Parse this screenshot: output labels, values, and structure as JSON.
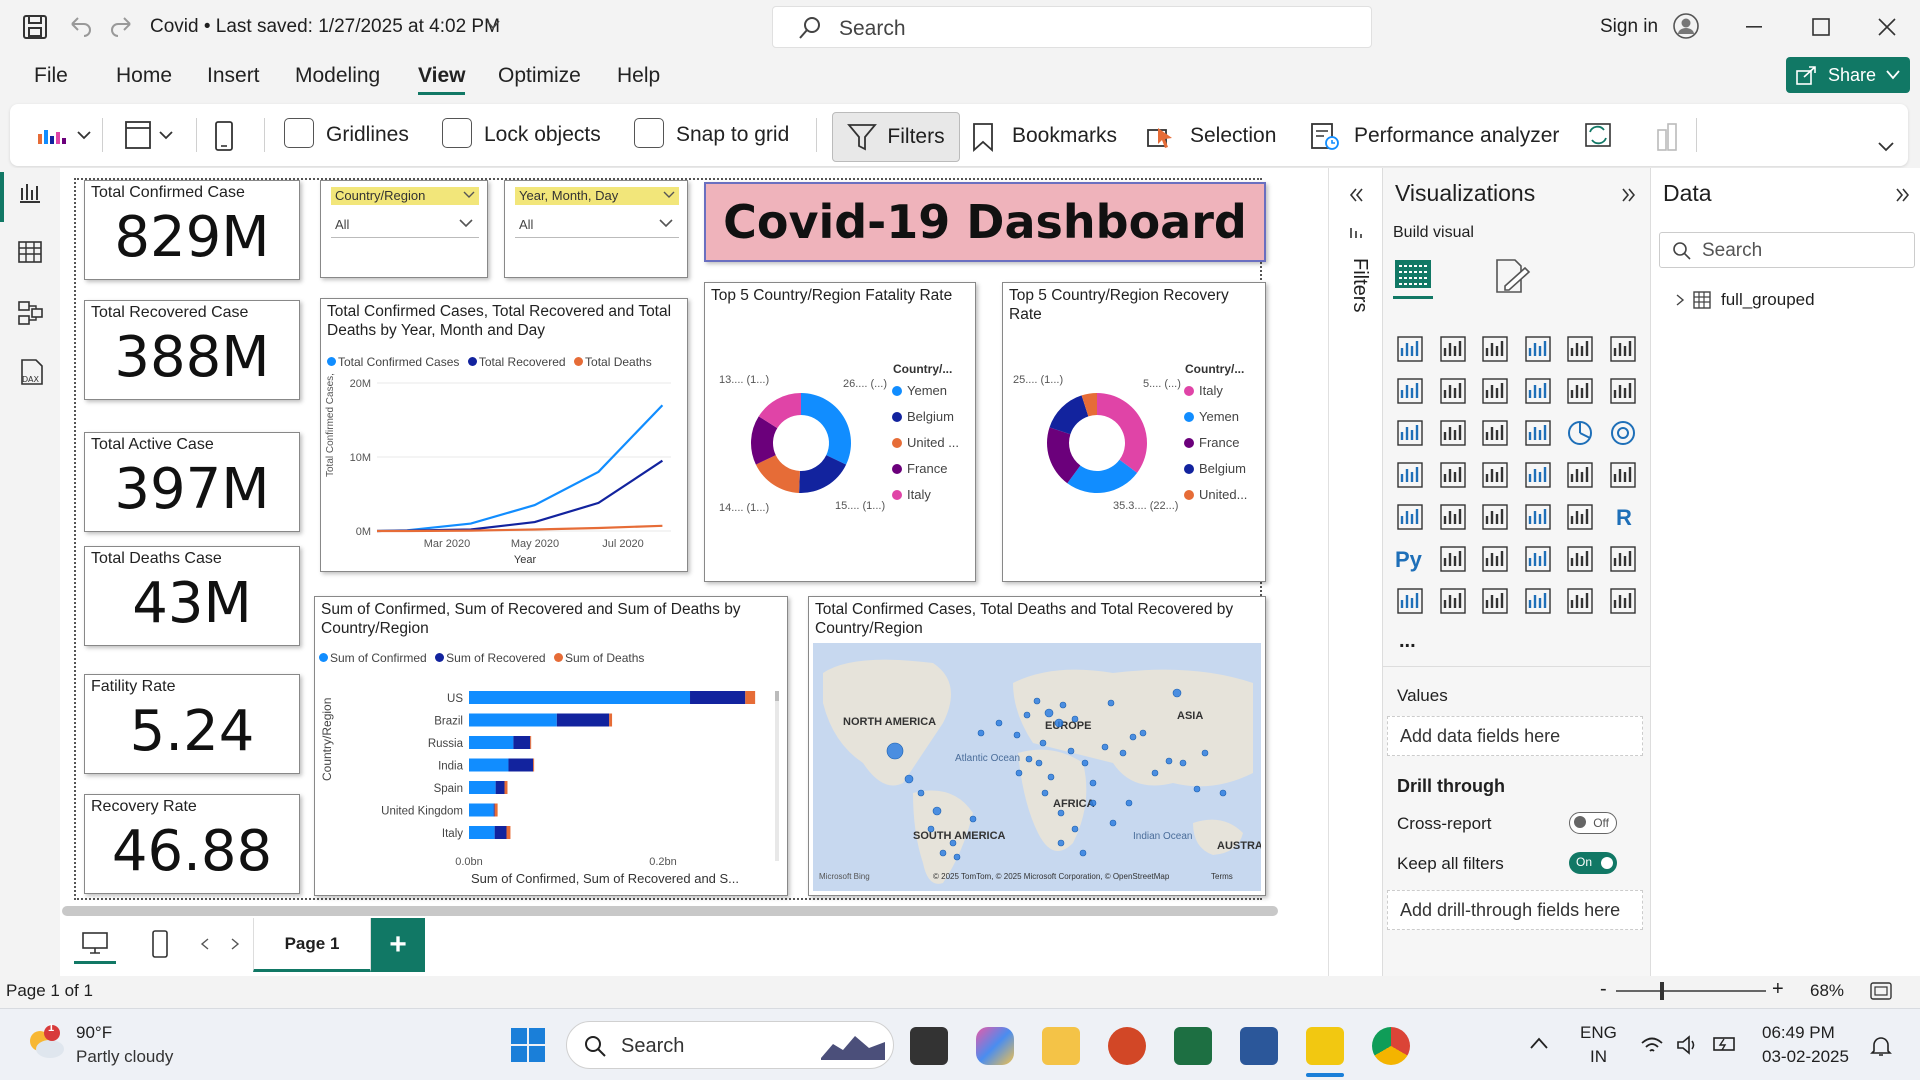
{
  "titlebar": {
    "doc_title": "Covid • Last saved: 1/27/2025 at 4:02 PM",
    "search_placeholder": "Search",
    "sign_in": "Sign in"
  },
  "menu": {
    "items": [
      "File",
      "Home",
      "Insert",
      "Modeling",
      "View",
      "Optimize",
      "Help"
    ],
    "active": "View",
    "share": "Share"
  },
  "ribbon": {
    "gridlines": "Gridlines",
    "lock_objects": "Lock objects",
    "snap_to_grid": "Snap to grid",
    "filters": "Filters",
    "bookmarks": "Bookmarks",
    "selection": "Selection",
    "performance_analyzer": "Performance analyzer"
  },
  "kpis": [
    {
      "label": "Total Confirmed Case",
      "value": "829M"
    },
    {
      "label": "Total Recovered Case",
      "value": "388M"
    },
    {
      "label": "Total Active Case",
      "value": "397M"
    },
    {
      "label": "Total Deaths Case",
      "value": "43M"
    },
    {
      "label": "Fatility Rate",
      "value": "5.24"
    },
    {
      "label": "Recovery Rate",
      "value": "46.88"
    }
  ],
  "slicers": [
    {
      "field": "Country/Region",
      "value": "All"
    },
    {
      "field": "Year, Month, Day",
      "value": "All"
    }
  ],
  "dashboard_title": "Covid-19 Dashboard",
  "line_chart": {
    "title": "Total Confirmed Cases, Total Recovered and Total Deaths by Year, Month and Day",
    "legend": [
      "Total Confirmed Cases",
      "Total Recovered",
      "Total Deaths"
    ],
    "colors": [
      "#118DFF",
      "#12239E",
      "#E66C37"
    ],
    "y_ticks": [
      "20M",
      "10M",
      "0M"
    ],
    "x_ticks": [
      "Mar 2020",
      "May 2020",
      "Jul 2020"
    ],
    "ylabel": "Total Confirmed Cases, Total ...",
    "xlabel": "Year"
  },
  "donut_fatality": {
    "title": "Top 5 Country/Region Fatality Rate",
    "legend_title": "Country/...",
    "legend": [
      "Yemen",
      "Belgium",
      "United ...",
      "France",
      "Italy"
    ],
    "colors": [
      "#118DFF",
      "#12239E",
      "#E66C37",
      "#6B007B",
      "#E044A7"
    ],
    "labels": [
      "13.... (1...)",
      "26.... (...)",
      "14.... (1...)",
      "15.... (1...)"
    ]
  },
  "donut_recovery": {
    "title": "Top 5 Country/Region Recovery Rate",
    "legend_title": "Country/...",
    "legend": [
      "Italy",
      "Yemen",
      "France",
      "Belgium",
      "United..."
    ],
    "colors": [
      "#E044A7",
      "#118DFF",
      "#6B007B",
      "#12239E",
      "#E66C37"
    ],
    "labels": [
      "25.... (1...)",
      "5.... (...)",
      "35.3.... (22...)"
    ]
  },
  "bar_chart": {
    "title": "Sum of Confirmed, Sum of Recovered and Sum of Deaths by Country/Region",
    "legend": [
      "Sum of Confirmed",
      "Sum of Recovered",
      "Sum of Deaths"
    ],
    "ylabel": "Country/Region",
    "xlabel": "Sum of Confirmed, Sum of Recovered and S...",
    "x_ticks": [
      "0.0bn",
      "0.2bn"
    ]
  },
  "map": {
    "title": "Total Confirmed Cases, Total Deaths and Total Recovered by Country/Region",
    "labels": [
      "NORTH AMERICA",
      "EUROPE",
      "ASIA",
      "Atlantic Ocean",
      "AFRICA",
      "SOUTH AMERICA",
      "Indian Ocean",
      "AUSTRAL"
    ],
    "brand": "Microsoft Bing",
    "credit": "© 2025 TomTom, © 2025 Microsoft Corporation, © OpenStreetMap",
    "terms": "Terms"
  },
  "chart_data": [
    {
      "type": "line",
      "x": [
        "Mar 2020",
        "Apr 2020",
        "May 2020",
        "Jun 2020",
        "Jul 2020"
      ],
      "series": [
        {
          "name": "Total Confirmed Cases",
          "values": [
            0.1,
            1.0,
            3.5,
            8.0,
            17.0
          ]
        },
        {
          "name": "Total Recovered",
          "values": [
            0.05,
            0.2,
            1.2,
            3.8,
            9.5
          ]
        },
        {
          "name": "Total Deaths",
          "values": [
            0,
            0.05,
            0.2,
            0.4,
            0.7
          ]
        }
      ],
      "ylim": [
        0,
        20
      ]
    },
    {
      "type": "pie",
      "categories": [
        "Yemen",
        "Belgium",
        "United ...",
        "France",
        "Italy"
      ],
      "values": [
        26,
        15,
        14,
        13,
        13
      ]
    },
    {
      "type": "pie",
      "categories": [
        "Italy",
        "Yemen",
        "France",
        "Belgium",
        "United..."
      ],
      "values": [
        35.3,
        25,
        20,
        15,
        5
      ]
    },
    {
      "type": "bar",
      "categories": [
        "US",
        "Brazil",
        "Russia",
        "India",
        "Spain",
        "United Kingdom",
        "Italy"
      ],
      "series": [
        {
          "name": "Sum of Confirmed",
          "values": [
            0.224,
            0.089,
            0.045,
            0.04,
            0.027,
            0.025,
            0.026
          ]
        },
        {
          "name": "Sum of Recovered",
          "values": [
            0.056,
            0.053,
            0.017,
            0.025,
            0.009,
            0.001,
            0.012
          ]
        },
        {
          "name": "Sum of Deaths",
          "values": [
            0.01,
            0.003,
            0.001,
            0.001,
            0.003,
            0.003,
            0.004
          ]
        }
      ],
      "xlim": [
        0,
        0.3
      ]
    }
  ],
  "panes": {
    "filters": "Filters",
    "visualizations": "Visualizations",
    "build_visual": "Build visual",
    "values": "Values",
    "add_data_fields": "Add data fields here",
    "drill_through": "Drill through",
    "cross_report": "Cross-report",
    "cross_report_state": "Off",
    "keep_all_filters": "Keep all filters",
    "keep_all_filters_state": "On",
    "add_drill_through": "Add drill-through fields here",
    "data": "Data",
    "data_search": "Search",
    "table": "full_grouped",
    "py": "Py",
    "r": "R",
    "more": "..."
  },
  "pagetabs": {
    "page1": "Page 1",
    "add": "+"
  },
  "status": {
    "page": "Page 1 of 1",
    "zoom": "68%"
  },
  "taskbar": {
    "weather_temp": "90°F",
    "weather_desc": "Partly cloudy",
    "weather_badge": "1",
    "search": "Search",
    "lang1": "ENG",
    "lang2": "IN",
    "time": "06:49 PM",
    "date": "03-02-2025"
  }
}
